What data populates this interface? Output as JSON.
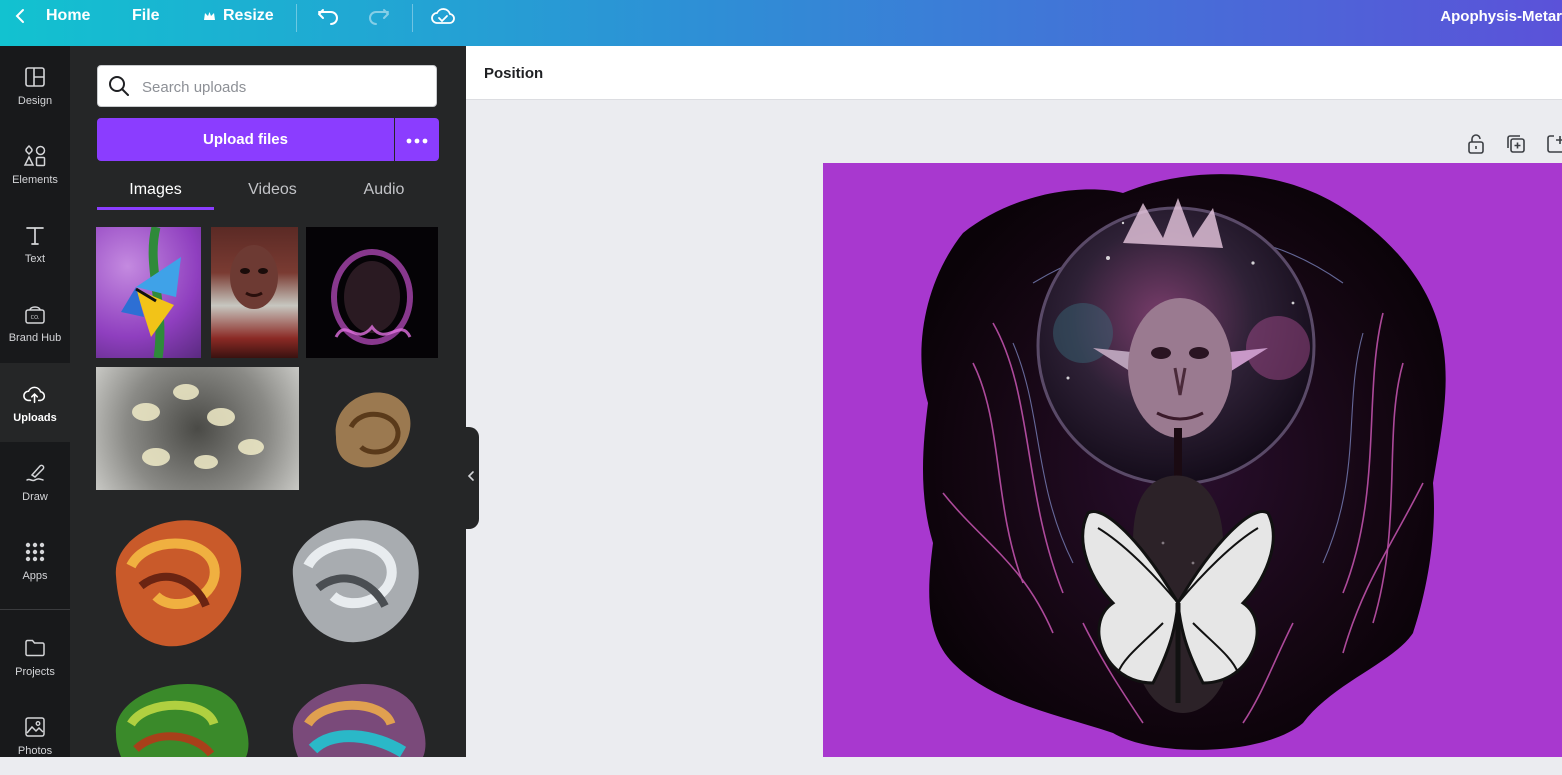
{
  "topbar": {
    "home_label": "Home",
    "file_label": "File",
    "resize_label": "Resize",
    "document_title": "Apophysis-Metar"
  },
  "rail": {
    "items": [
      {
        "label": "Design",
        "icon": "layout-icon"
      },
      {
        "label": "Elements",
        "icon": "shapes-icon"
      },
      {
        "label": "Text",
        "icon": "text-icon"
      },
      {
        "label": "Brand Hub",
        "icon": "brand-hub-icon"
      },
      {
        "label": "Uploads",
        "icon": "cloud-upload-icon",
        "active": true
      },
      {
        "label": "Draw",
        "icon": "draw-icon"
      },
      {
        "label": "Apps",
        "icon": "apps-grid-icon"
      },
      {
        "label": "Projects",
        "icon": "folder-icon"
      },
      {
        "label": "Photos",
        "icon": "photo-icon"
      }
    ]
  },
  "panel": {
    "search_placeholder": "Search uploads",
    "upload_button_label": "Upload files",
    "tabs": [
      {
        "label": "Images",
        "active": true
      },
      {
        "label": "Videos"
      },
      {
        "label": "Audio"
      }
    ]
  },
  "editor": {
    "position_label": "Position"
  },
  "colors": {
    "accent": "#8b3dff",
    "page_background": "#a838cf",
    "panel_background": "#252627",
    "rail_background": "#18191b"
  }
}
